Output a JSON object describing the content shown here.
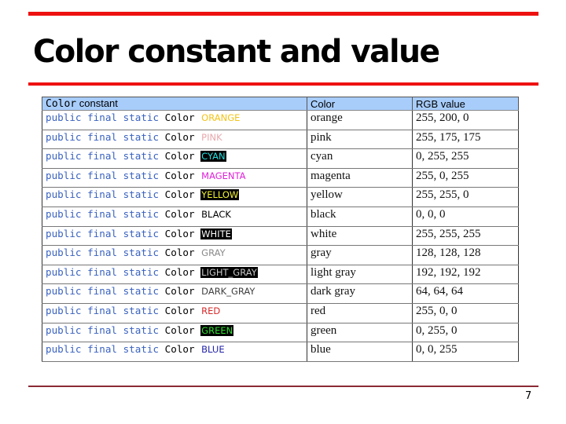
{
  "slide": {
    "title": "Color constant and value",
    "page_number": "7",
    "accent_color": "#ee1111",
    "footer_rule_color": "#8b2a35"
  },
  "table": {
    "header": {
      "col1_code": "Color",
      "col1_text": " constant",
      "col2": "Color",
      "col3": "RGB value",
      "background": "#a8cdfb"
    },
    "declaration_prefix": "public final static",
    "declaration_type": "Color",
    "rows": [
      {
        "constant": "ORANGE",
        "color": "orange",
        "rgb": "255, 200, 0",
        "fg": "#f2c418",
        "bg": "transparent"
      },
      {
        "constant": "PINK",
        "color": "pink",
        "rgb": "255, 175, 175",
        "fg": "#e8a8ac",
        "bg": "transparent"
      },
      {
        "constant": "CYAN",
        "color": "cyan",
        "rgb": "0, 255, 255",
        "fg": "#22e0e0",
        "bg": "#000000"
      },
      {
        "constant": "MAGENTA",
        "color": "magenta",
        "rgb": "255, 0, 255",
        "fg": "#e020d8",
        "bg": "transparent"
      },
      {
        "constant": "YELLOW",
        "color": "yellow",
        "rgb": "255, 255, 0",
        "fg": "#f2f230",
        "bg": "#000000"
      },
      {
        "constant": "BLACK",
        "color": "black",
        "rgb": "0, 0, 0",
        "fg": "#000000",
        "bg": "transparent"
      },
      {
        "constant": "WHITE",
        "color": "white",
        "rgb": "255, 255, 255",
        "fg": "#ffffff",
        "bg": "#000000"
      },
      {
        "constant": "GRAY",
        "color": "gray",
        "rgb": "128, 128, 128",
        "fg": "#8a8a8a",
        "bg": "transparent"
      },
      {
        "constant": "LIGHT_GRAY",
        "color": "light gray",
        "rgb": "192, 192, 192",
        "fg": "#c8c8c8",
        "bg": "#000000"
      },
      {
        "constant": "DARK_GRAY",
        "color": "dark gray",
        "rgb": "64, 64, 64",
        "fg": "#404040",
        "bg": "transparent"
      },
      {
        "constant": "RED",
        "color": "red",
        "rgb": "255, 0, 0",
        "fg": "#d42a2a",
        "bg": "transparent"
      },
      {
        "constant": "GREEN",
        "color": "green",
        "rgb": "0, 255, 0",
        "fg": "#30e030",
        "bg": "#000000"
      },
      {
        "constant": "BLUE",
        "color": "blue",
        "rgb": "0, 0, 255",
        "fg": "#2222a8",
        "bg": "transparent"
      }
    ]
  }
}
